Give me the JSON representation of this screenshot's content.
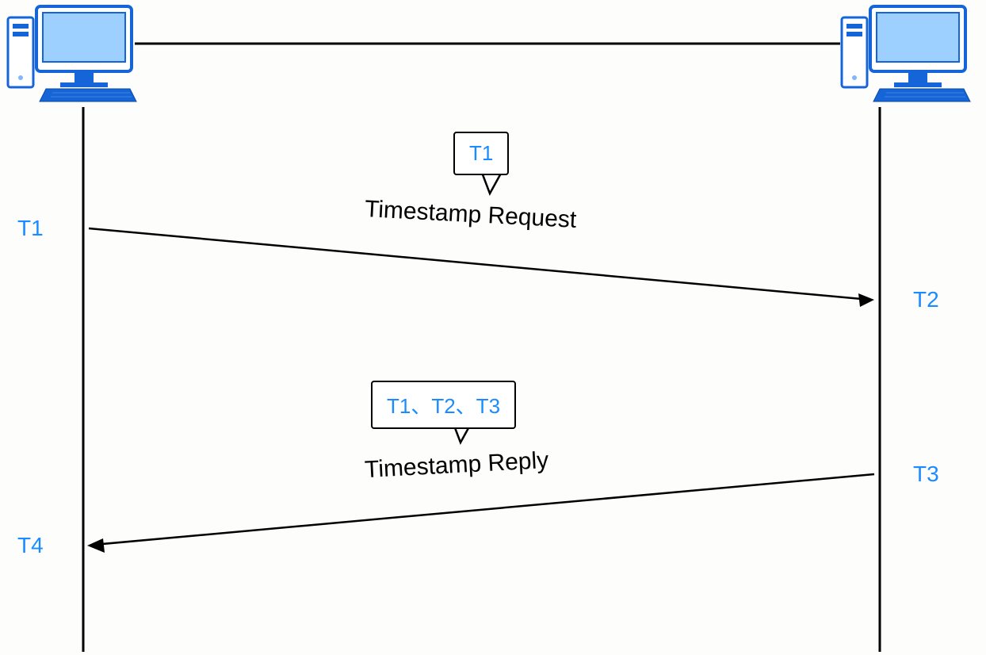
{
  "diagram": {
    "left_marker_send": "T1",
    "right_marker_recv": "T2",
    "right_marker_send": "T3",
    "left_marker_recv": "T4",
    "request_label": "Timestamp Request",
    "reply_label": "Timestamp Reply",
    "bubble_request": "T1",
    "bubble_reply": "T1、T2、T3",
    "colors": {
      "accent": "#1b8cff",
      "line": "#000000"
    }
  }
}
